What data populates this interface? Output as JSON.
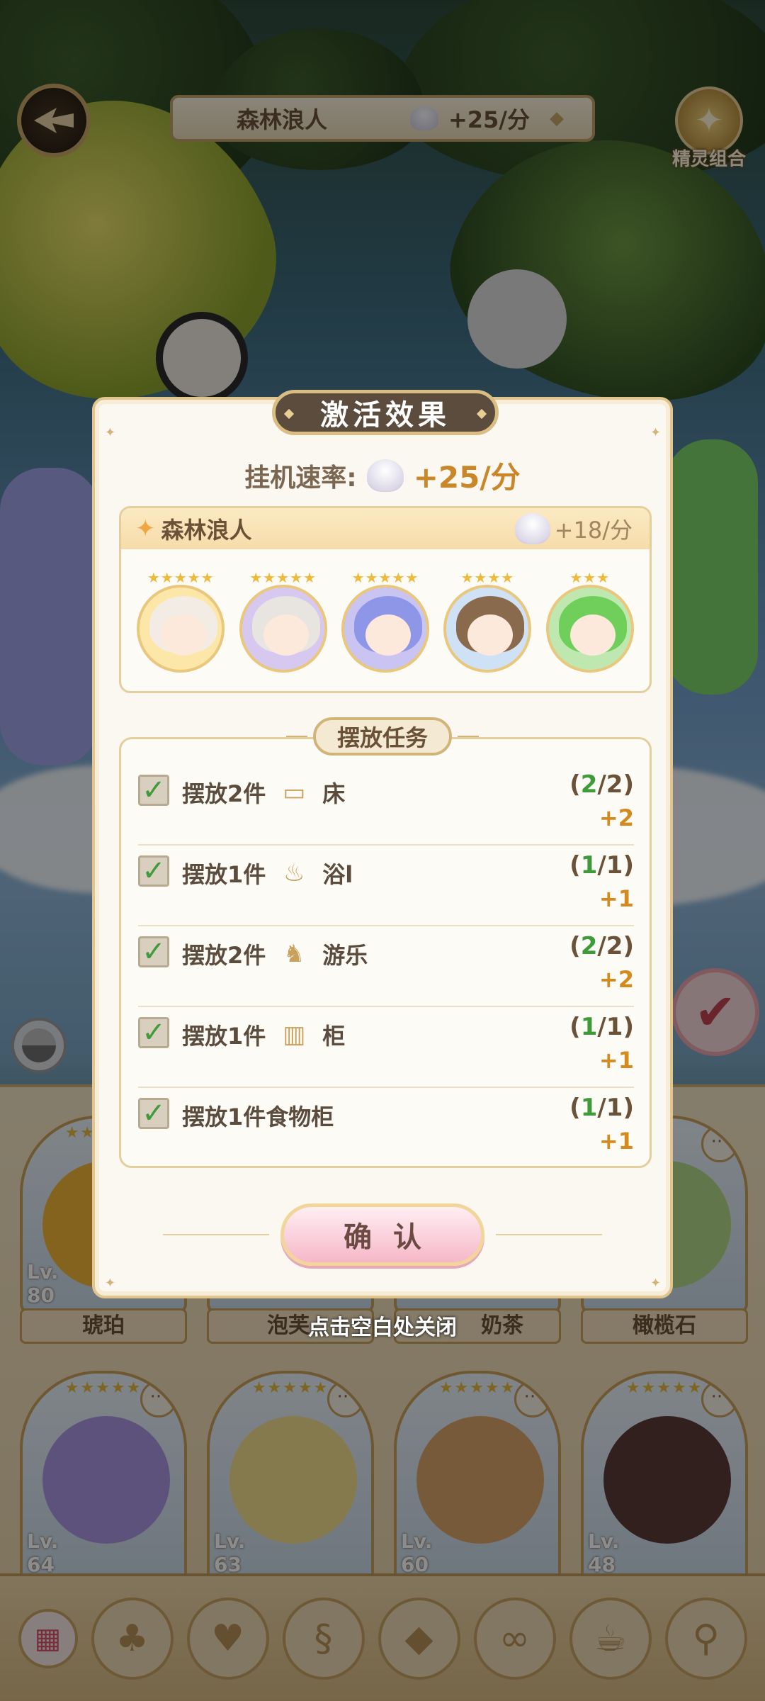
{
  "header": {
    "title": "森林浪人",
    "rate": "+25/分",
    "combo_label": "精灵组合"
  },
  "popup": {
    "tab_title": "激活效果",
    "speed_label": "挂机速率:",
    "speed_value": "+25/分",
    "group": {
      "name": "森林浪人",
      "rate": "+18/分",
      "members": [
        {
          "stars": "★★★★★",
          "hair": "#f3ece4"
        },
        {
          "stars": "★★★★★",
          "hair": "#e8e4df"
        },
        {
          "stars": "★★★★★",
          "hair": "#8e96e8"
        },
        {
          "stars": "★★★★",
          "hair": "#8a6a4c"
        },
        {
          "stars": "★★★",
          "hair": "#6fcf5a"
        }
      ]
    },
    "task_title": "摆放任务",
    "tasks": [
      {
        "text": "摆放2件",
        "icon": "bed-icon",
        "glyph": "▭",
        "category": "床",
        "done": "2",
        "total": "/2)",
        "open": "(",
        "reward": "+2"
      },
      {
        "text": "摆放1件",
        "icon": "bath-icon",
        "glyph": "♨",
        "category": "浴l",
        "done": "1",
        "total": "/1)",
        "open": "(",
        "reward": "+1"
      },
      {
        "text": "摆放2件",
        "icon": "rocking-horse-icon",
        "glyph": "♞",
        "category": "游乐",
        "done": "2",
        "total": "/2)",
        "open": "(",
        "reward": "+2"
      },
      {
        "text": "摆放1件",
        "icon": "cabinet-icon",
        "glyph": "▥",
        "category": "柜",
        "done": "1",
        "total": "/1)",
        "open": "(",
        "reward": "+1"
      },
      {
        "text": "摆放1件食物柜",
        "icon": "",
        "glyph": "",
        "category": "",
        "done": "1",
        "total": "/1)",
        "open": "(",
        "reward": "+1"
      }
    ],
    "confirm_label": "确认"
  },
  "close_hint": "点击空白处关闭",
  "cards_row1": [
    {
      "name": "琥珀",
      "lv": "80"
    },
    {
      "name": "泡芙",
      "lv": ""
    },
    {
      "name": "奶茶",
      "lv": ""
    },
    {
      "name": "橄榄石",
      "lv": ""
    }
  ],
  "cards_row2": [
    {
      "lv": "64"
    },
    {
      "lv": "63"
    },
    {
      "lv": "60"
    },
    {
      "lv": "48"
    }
  ],
  "lv_prefix": "Lv.",
  "colors": {
    "accent_gold": "#c9872a",
    "done_green": "#3f9b3a",
    "confirm_pink": "#f6b7c8"
  }
}
